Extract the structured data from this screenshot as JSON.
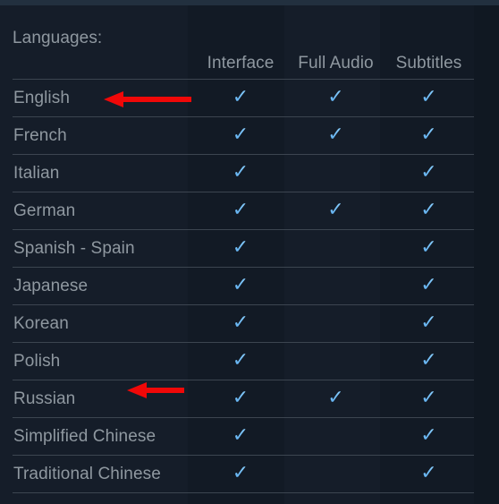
{
  "section": {
    "label": "Languages:"
  },
  "colors": {
    "background": "#0f1621",
    "text": "#8f98a0",
    "check": "#67c1f5",
    "arrow": "#f00808",
    "divider": "#3c4550"
  },
  "table": {
    "columns": [
      {
        "key": "language",
        "label": ""
      },
      {
        "key": "interface",
        "label": "Interface"
      },
      {
        "key": "full_audio",
        "label": "Full Audio"
      },
      {
        "key": "subtitles",
        "label": "Subtitles"
      }
    ],
    "check_glyph": "✓",
    "rows": [
      {
        "language": "English",
        "interface": true,
        "full_audio": true,
        "subtitles": true
      },
      {
        "language": "French",
        "interface": true,
        "full_audio": true,
        "subtitles": true
      },
      {
        "language": "Italian",
        "interface": true,
        "full_audio": false,
        "subtitles": true
      },
      {
        "language": "German",
        "interface": true,
        "full_audio": true,
        "subtitles": true
      },
      {
        "language": "Spanish - Spain",
        "interface": true,
        "full_audio": false,
        "subtitles": true
      },
      {
        "language": "Japanese",
        "interface": true,
        "full_audio": false,
        "subtitles": true
      },
      {
        "language": "Korean",
        "interface": true,
        "full_audio": false,
        "subtitles": true
      },
      {
        "language": "Polish",
        "interface": true,
        "full_audio": false,
        "subtitles": true
      },
      {
        "language": "Russian",
        "interface": true,
        "full_audio": true,
        "subtitles": true
      },
      {
        "language": "Simplified Chinese",
        "interface": true,
        "full_audio": false,
        "subtitles": true
      },
      {
        "language": "Traditional Chinese",
        "interface": true,
        "full_audio": false,
        "subtitles": true
      }
    ]
  },
  "annotations": [
    {
      "name": "arrow-english",
      "points_to": "English",
      "direction": "left"
    },
    {
      "name": "arrow-russian",
      "points_to": "Russian",
      "direction": "left"
    }
  ]
}
